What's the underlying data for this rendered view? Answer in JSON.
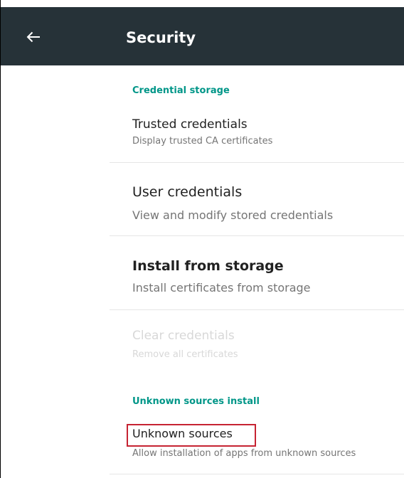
{
  "appbar": {
    "title": "Security",
    "back_icon": "arrow-back-icon",
    "background": "#263238"
  },
  "sections": {
    "credential_storage": {
      "header": "Credential storage",
      "items": [
        {
          "title": "Trusted credentials",
          "subtitle": "Display trusted CA certificates",
          "enabled": true
        },
        {
          "title": "User credentials",
          "subtitle": "View and modify stored credentials",
          "enabled": true
        },
        {
          "title": "Install from storage",
          "subtitle": "Install certificates from storage",
          "enabled": true
        },
        {
          "title": "Clear credentials",
          "subtitle": "Remove all certificates",
          "enabled": false
        }
      ]
    },
    "unknown_sources": {
      "header": "Unknown sources install",
      "items": [
        {
          "title": "Unknown sources",
          "subtitle": "Allow installation of apps from unknown sources",
          "enabled": true,
          "highlighted": true
        }
      ]
    }
  },
  "colors": {
    "accent": "#009688",
    "highlight": "#c62332",
    "disabled_text": "#d8d8d8"
  }
}
